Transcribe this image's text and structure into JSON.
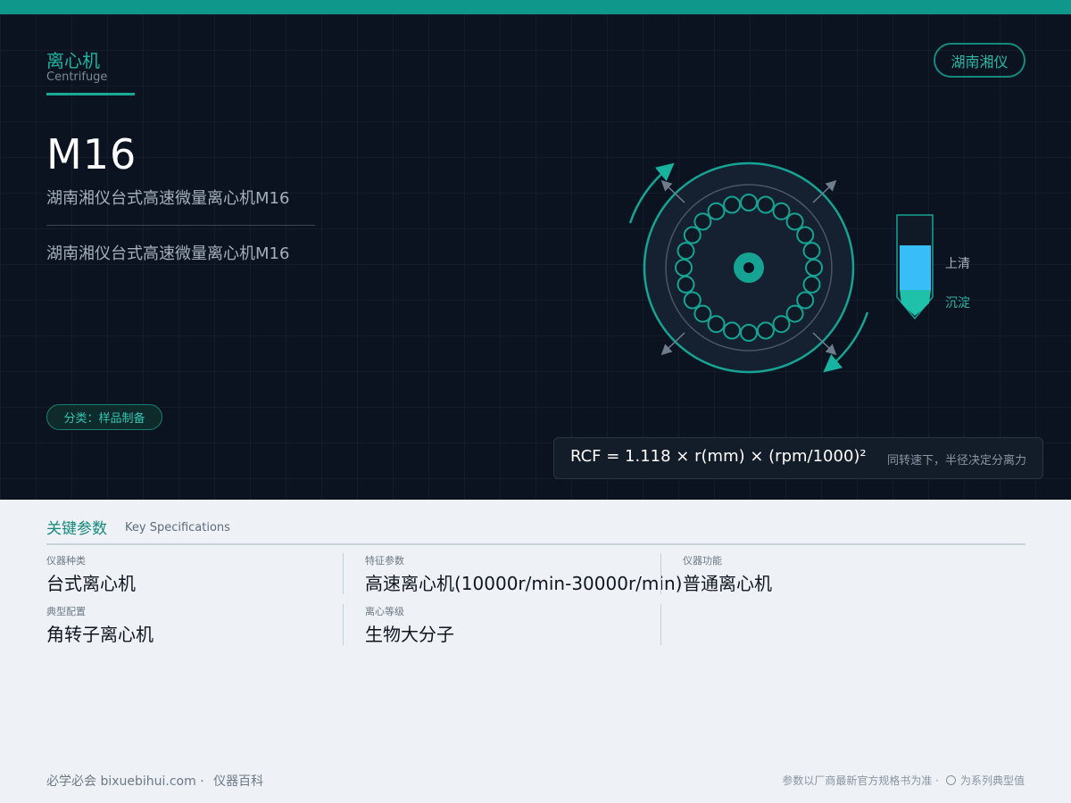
{
  "category": {
    "zh": "离心机",
    "en": "Centrifuge"
  },
  "brand": "湖南湘仪",
  "product": {
    "model": "M16",
    "subtitle": "湖南湘仪台式高速微量离心机M16",
    "description": "湖南湘仪台式高速微量离心机M16"
  },
  "tag": "分类：样品制备",
  "tube": {
    "top_label": "上清",
    "bottom_label": "沉淀"
  },
  "formula": {
    "text": "RCF = 1.118 × r(mm) × (rpm/1000)²",
    "note": "同转速下，半径决定分离力"
  },
  "specs": {
    "title": "关键参数",
    "subtitle": "Key Specifications",
    "items": [
      {
        "label": "仪器种类",
        "value": "台式离心机"
      },
      {
        "label": "特征参数",
        "value": "高速离心机(10000r/min-30000r/min)"
      },
      {
        "label": "仪器功能",
        "value": "普通离心机"
      },
      {
        "label": "典型配置",
        "value": "角转子离心机"
      },
      {
        "label": "离心等级",
        "value": "生物大分子"
      }
    ]
  },
  "footer": {
    "site": "必学必会 bixuebihui.com ·",
    "section": "仪器百科",
    "note": "参数以厂商最新官方规格书为准 ·",
    "note2": "为系列典型值"
  },
  "colors": {
    "accent": "#0e978a",
    "hero_bg": "#0c1320",
    "panel_bg": "#eef2f6"
  }
}
